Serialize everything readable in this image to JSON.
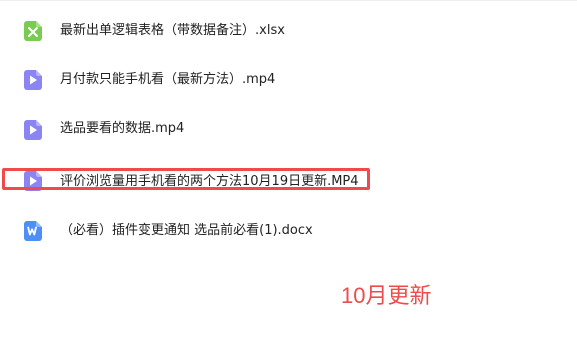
{
  "files": [
    {
      "name": "最新出单逻辑表格（带数据备注）.xlsx",
      "icon": "excel-file-icon",
      "color": "#7ACB52"
    },
    {
      "name": "月付款只能手机看（最新方法）.mp4",
      "icon": "video-file-icon",
      "color": "#8B85F4"
    },
    {
      "name": "选品要看的数据.mp4",
      "icon": "video-file-icon",
      "color": "#8B85F4"
    },
    {
      "name": "评价浏览量用手机看的两个方法10月19日更新.MP4",
      "icon": "video-file-icon",
      "color": "#8B85F4"
    },
    {
      "name": "（必看）插件变更通知 选品前必看(1).docx",
      "icon": "word-file-icon",
      "color": "#4D8EF7"
    }
  ],
  "annotation": {
    "text": "10月更新",
    "color": "#F04B4B"
  },
  "highlight_color": "#F04B4B"
}
